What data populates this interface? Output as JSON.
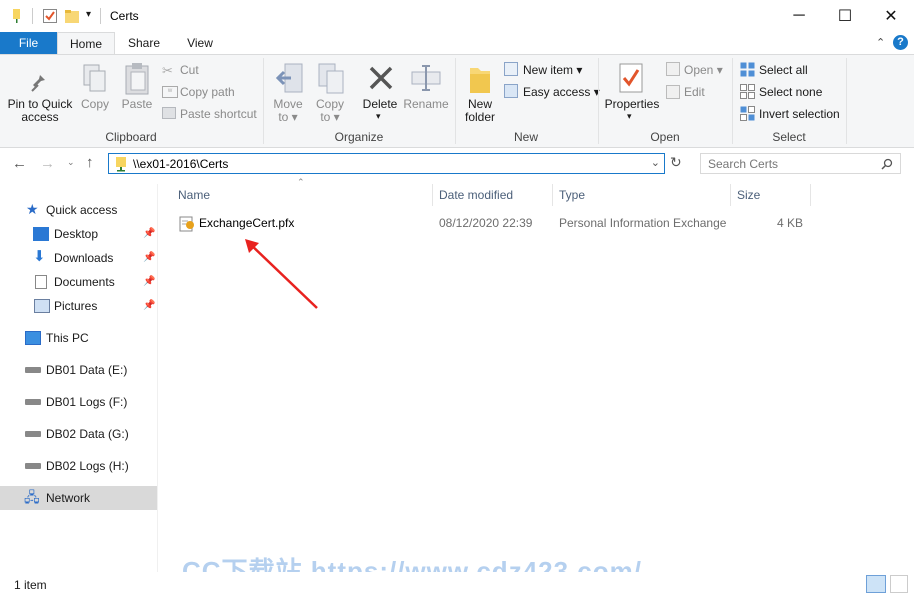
{
  "window": {
    "title": "Certs",
    "controls": {
      "minimize": "─",
      "maximize": "☐",
      "close": "✕"
    }
  },
  "tabs": {
    "file": "File",
    "home": "Home",
    "share": "Share",
    "view": "View"
  },
  "ribbon": {
    "clipboard": {
      "pin": "Pin to Quick access",
      "copy": "Copy",
      "paste": "Paste",
      "cut": "Cut",
      "copy_path": "Copy path",
      "paste_shortcut": "Paste shortcut",
      "label": "Clipboard"
    },
    "organize": {
      "move_to": "Move to",
      "copy_to": "Copy to",
      "delete": "Delete",
      "rename": "Rename",
      "label": "Organize"
    },
    "new": {
      "new_folder": "New folder",
      "new_item": "New item",
      "easy_access": "Easy access",
      "label": "New"
    },
    "open": {
      "properties": "Properties",
      "open": "Open",
      "edit": "Edit",
      "label": "Open"
    },
    "select": {
      "select_all": "Select all",
      "select_none": "Select none",
      "invert": "Invert selection",
      "label": "Select"
    }
  },
  "address": {
    "path": "\\\\ex01-2016\\Certs",
    "search_placeholder": "Search Certs"
  },
  "nav": {
    "quick_access": "Quick access",
    "desktop": "Desktop",
    "downloads": "Downloads",
    "documents": "Documents",
    "pictures": "Pictures",
    "this_pc": "This PC",
    "db01_data": "DB01 Data (E:)",
    "db01_logs": "DB01 Logs (F:)",
    "db02_data": "DB02 Data (G:)",
    "db02_logs": "DB02 Logs (H:)",
    "network": "Network"
  },
  "columns": {
    "name": "Name",
    "date": "Date modified",
    "type": "Type",
    "size": "Size"
  },
  "files": [
    {
      "name": "ExchangeCert.pfx",
      "date": "08/12/2020 22:39",
      "type": "Personal Information Exchange",
      "size": "4 KB"
    }
  ],
  "status": {
    "count": "1 item"
  },
  "watermark": "CC下载站 https://www.cdz423.com/",
  "colors": {
    "accent": "#1979ca",
    "selected_nav": "#d9d9d9",
    "arrow": "#e8221f"
  }
}
